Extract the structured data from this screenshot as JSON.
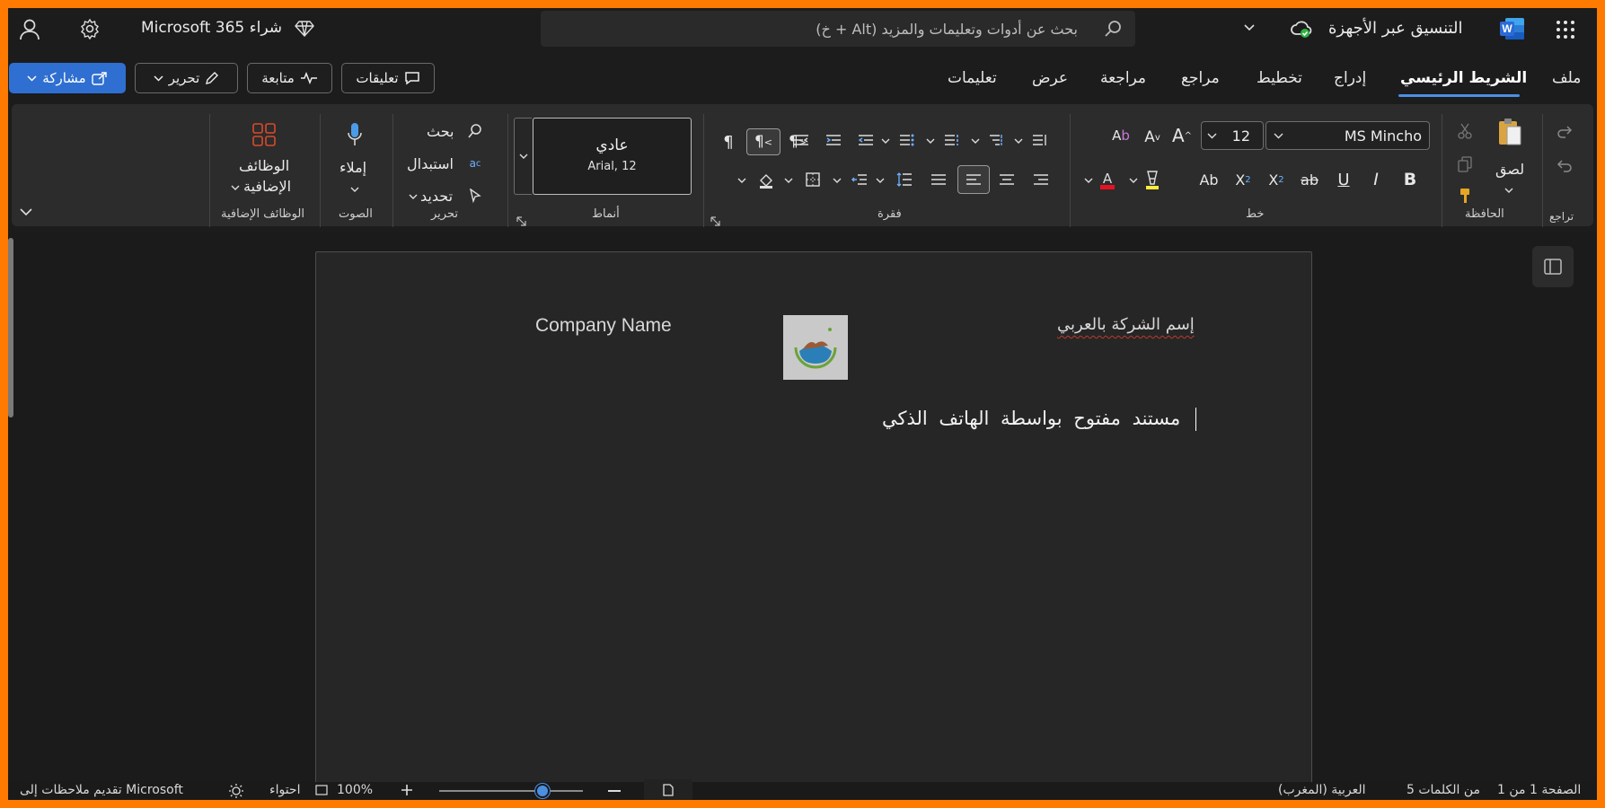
{
  "titlebar": {
    "app_name": "التنسيق عبر الأجهزة",
    "buy_label": "شراء Microsoft 365",
    "search_placeholder": "بحث عن أدوات وتعليمات والمزيد (Alt + خ)"
  },
  "tabs": [
    "ملف",
    "الشريط الرئيسي",
    "إدراج",
    "تخطيط",
    "مراجع",
    "مراجعة",
    "عرض",
    "تعليمات"
  ],
  "active_tab": "الشريط الرئيسي",
  "actions": {
    "comments": "تعليقات",
    "catchup": "متابعة",
    "editing": "تحرير",
    "share": "مشاركة"
  },
  "ribbon": {
    "undo_group": "تراجع",
    "clipboard": {
      "paste": "لصق",
      "group": "الحافظة"
    },
    "font": {
      "name": "MS Mincho",
      "size": "12",
      "group": "خط"
    },
    "paragraph": {
      "group": "فقرة"
    },
    "styles": {
      "style_name": "عادي",
      "style_font": "Arial, 12",
      "group": "أنماط"
    },
    "editing": {
      "find": "بحث",
      "replace": "استبدال",
      "select": "تحديد",
      "group": "تحرير"
    },
    "voice": {
      "dictate": "إملاء",
      "group": "الصوت"
    },
    "addins": {
      "label_line1": "الوظائف",
      "label_line2": "الإضافية",
      "group": "الوظائف الإضافية"
    }
  },
  "document": {
    "company_ar": "إسم الشركة بالعربي",
    "company_en": "Company Name",
    "body_text": "مستند مفتوح بواسطة الهاتف الذكي"
  },
  "status": {
    "page": "الصفحة 1 من 1",
    "words": "5 من الكلمات",
    "language": "العربية (المغرب)",
    "zoom": "100%",
    "fit": "احتواء",
    "feedback": "تقديم ملاحظات إلى Microsoft",
    "zoom_level": 0.72
  },
  "colors": {
    "accent": "#4b8fe2",
    "share_bg": "#2f6fd1",
    "frame": "#ff7a00",
    "word_icon": "#2b6bd6",
    "font_color_red": "#e81123",
    "highlight_yellow": "#ffeb3b"
  },
  "icons": [
    "waffle-icon",
    "word-icon",
    "sync-check-icon",
    "search-icon",
    "diamond-icon",
    "settings-icon",
    "account-icon"
  ]
}
